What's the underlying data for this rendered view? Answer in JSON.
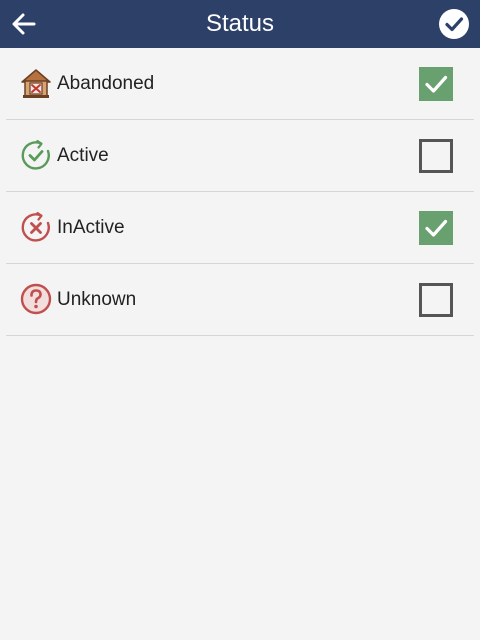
{
  "appbar": {
    "title": "Status"
  },
  "colors": {
    "appbar": "#2d4168",
    "checked": "#68a070",
    "active_icon": "#5a9a5a",
    "inactive_icon": "#c0504d",
    "unknown_icon": "#c0504d"
  },
  "items": [
    {
      "label": "Abandoned",
      "icon": "abandoned-house-icon",
      "checked": true
    },
    {
      "label": "Active",
      "icon": "active-check-icon",
      "checked": false
    },
    {
      "label": "InActive",
      "icon": "inactive-x-icon",
      "checked": true
    },
    {
      "label": "Unknown",
      "icon": "unknown-question-icon",
      "checked": false
    }
  ]
}
